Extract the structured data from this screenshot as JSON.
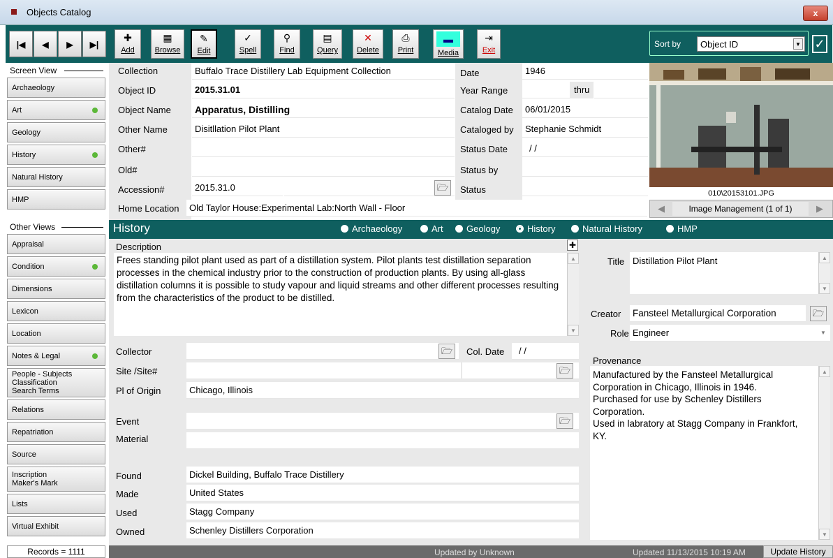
{
  "window": {
    "title": "Objects Catalog",
    "close": "x"
  },
  "toolbar": {
    "nav": [
      "|◀",
      "◀",
      "▶",
      "▶|"
    ],
    "buttons": [
      {
        "icon": "✚",
        "label": "Add"
      },
      {
        "icon": "▦",
        "label": "Browse"
      },
      {
        "icon": "✎",
        "label": "Edit"
      },
      {
        "icon": "✓",
        "label": "Spell"
      },
      {
        "icon": "⚲",
        "label": "Find"
      },
      {
        "icon": "▤",
        "label": "Query"
      },
      {
        "icon": "✕",
        "label": "Delete"
      },
      {
        "icon": "⎙",
        "label": "Print"
      },
      {
        "icon": "▬",
        "label": "Media"
      },
      {
        "icon": "⇥",
        "label": "Exit"
      }
    ],
    "sort_label": "Sort by",
    "sort_value": "Object ID"
  },
  "sidebar": {
    "screen_view_title": "Screen View",
    "screen_views": [
      {
        "label": "Archaeology",
        "dot": false
      },
      {
        "label": "Art",
        "dot": true
      },
      {
        "label": "Geology",
        "dot": false
      },
      {
        "label": "History",
        "dot": true
      },
      {
        "label": "Natural History",
        "dot": false
      },
      {
        "label": "HMP",
        "dot": false
      }
    ],
    "other_views_title": "Other Views",
    "other_views": [
      {
        "label": "Appraisal",
        "dot": false
      },
      {
        "label": "Condition",
        "dot": true
      },
      {
        "label": "Dimensions",
        "dot": false
      },
      {
        "label": "Lexicon",
        "dot": false
      },
      {
        "label": "Location",
        "dot": false
      },
      {
        "label": "Notes & Legal",
        "dot": true
      },
      {
        "label": "People - Subjects\nClassification\nSearch Terms",
        "dot": false
      },
      {
        "label": "Relations",
        "dot": false
      },
      {
        "label": "Repatriation",
        "dot": false
      },
      {
        "label": "Source",
        "dot": false
      },
      {
        "label": "Inscription\nMaker's Mark",
        "dot": false
      },
      {
        "label": "Lists",
        "dot": false
      },
      {
        "label": "Virtual Exhibit",
        "dot": false
      }
    ],
    "records": "Records = 1111"
  },
  "header": {
    "collection_label": "Collection",
    "collection": "Buffalo Trace Distillery Lab Equipment Collection",
    "objectid_label": "Object ID",
    "objectid": "2015.31.01",
    "objectname_label": "Object Name",
    "objectname": "Apparatus, Distilling",
    "othername_label": "Other Name",
    "othername": "Disitllation Pilot Plant",
    "othernum_label": "Other#",
    "othernum": "",
    "oldnum_label": "Old#",
    "oldnum": "",
    "accession_label": "Accession#",
    "accession": "2015.31.0",
    "homeloc_label": "Home Location",
    "homeloc": "Old Taylor House:Experimental Lab:North Wall - Floor",
    "date_label": "Date",
    "date": "1946",
    "yearrange_label": "Year Range",
    "thru": "thru",
    "catdate_label": "Catalog Date",
    "catdate": "06/01/2015",
    "catby_label": "Cataloged by",
    "catby": "Stephanie Schmidt",
    "statusdate_label": "Status Date",
    "statusdate": "/ /",
    "statusby_label": "Status by",
    "statusby": "",
    "status_label": "Status",
    "status": ""
  },
  "image": {
    "filename": "010\\20153101.JPG",
    "mgmt": "Image Management (1 of 1)"
  },
  "history": {
    "title": "History",
    "radios": [
      {
        "label": "Archaeology",
        "selected": false
      },
      {
        "label": "Art",
        "selected": false
      },
      {
        "label": "Geology",
        "selected": false
      },
      {
        "label": "History",
        "selected": true
      },
      {
        "label": "Natural History",
        "selected": false
      },
      {
        "label": "HMP",
        "selected": false
      }
    ],
    "description_label": "Description",
    "description": "Frees standing pilot plant used as part of a distillation system. Pilot plants test distillation separation processes in the chemical industry prior to the construction of production plants. By using all-glass distillation columns it is possible to study vapour and liquid streams and other different processes resulting from the characteristics of the product to be distilled.",
    "collector_label": "Collector",
    "collector": "",
    "coldate_label": "Col. Date",
    "coldate": "/ /",
    "site_label": "Site /Site#",
    "site": "",
    "origin_label": "Pl of Origin",
    "origin": "Chicago, Illinois",
    "event_label": "Event",
    "event": "",
    "material_label": "Material",
    "material": "",
    "found_label": "Found",
    "found": "Dickel Building, Buffalo Trace Distillery",
    "made_label": "Made",
    "made": "United States",
    "used_label": "Used",
    "used": "Stagg Company",
    "owned_label": "Owned",
    "owned": "Schenley Distillers Corporation",
    "title_label": "Title",
    "title_val": "Distillation Pilot Plant",
    "creator_label": "Creator",
    "creator": "Fansteel Metallurgical Corporation",
    "role_label": "Role",
    "role": "Engineer",
    "provenance_label": "Provenance",
    "provenance": "Manufactured by the Fansteel Metallurgical Corporation in Chicago, Illinois in 1946.\nPurchased for use by Schenley Distillers Corporation.\nUsed in labratory at Stagg Company in Frankfort, KY."
  },
  "status": {
    "updated_by": "Updated by  Unknown",
    "updated": "Updated   11/13/2015 10:19 AM",
    "update_history": "Update History"
  }
}
